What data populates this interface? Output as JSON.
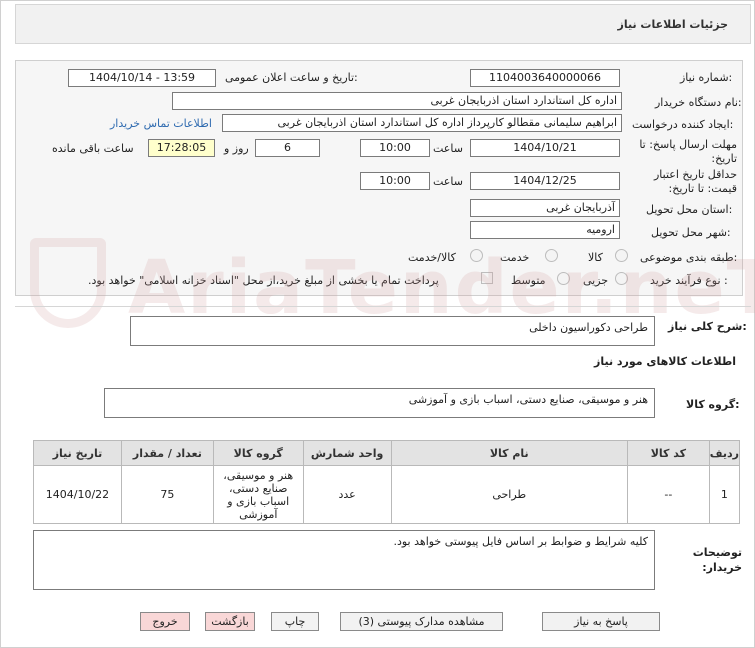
{
  "header": {
    "title": "جزئیات اطلاعات نیاز"
  },
  "labels": {
    "need_number": "شماره نیاز:",
    "announce_datetime": "تاریخ و ساعت اعلان عمومی:",
    "buyer_org": "نام دستگاه خریدار:",
    "requester": "ایجاد کننده درخواست:",
    "reply_deadline": "مهلت ارسال پاسخ: تا تاریخ:",
    "price_validity": "حداقل تاریخ اعتبار قیمت: تا تاریخ:",
    "delivery_province": "استان محل تحویل:",
    "delivery_city": "شهر محل تحویل:",
    "category": "طبقه بندی موضوعی:",
    "purchase_type": "نوع فرآیند خرید :",
    "time": "ساعت",
    "day_and": "روز و",
    "remaining": "ساعت باقی مانده"
  },
  "values": {
    "need_number": "1104003640000066",
    "announce_datetime": "1404/10/14 - 13:59",
    "buyer_org": "اداره کل استاندارد استان اذربایجان غربی",
    "requester": "ابراهیم سلیمانی مقطالو کارپرداز اداره کل استاندارد استان اذربایجان غربی",
    "contact_link": "اطلاعات تماس خریدار",
    "reply_date": "1404/10/21",
    "reply_time": "10:00",
    "reply_days": "6",
    "reply_remaining": "17:28:05",
    "validity_date": "1404/12/25",
    "validity_time": "10:00",
    "province": "آذربایجان غربی",
    "city": "ارومیه"
  },
  "category_options": [
    "کالا",
    "خدمت",
    "کالا/خدمت"
  ],
  "purchase_options": [
    "جزیی",
    "متوسط"
  ],
  "payment_note": "پرداخت تمام یا بخشی از مبلغ خرید،از محل \"اسناد خزانه اسلامی\" خواهد بود.",
  "description": {
    "label": "شرح کلی نیاز:",
    "value": "طراحی دکوراسیون داخلی"
  },
  "goods_section": {
    "title": "اطلاعات کالاهای مورد نیاز",
    "group_label": "گروه کالا:",
    "group_value": "هنر و موسیقی، صنایع دستی، اسباب بازی و آموزشی"
  },
  "table": {
    "headers": [
      "ردیف",
      "کد کالا",
      "نام کالا",
      "واحد شمارش",
      "گروه کالا",
      "تعداد / مقدار",
      "تاریخ نیاز"
    ],
    "rows": [
      [
        "1",
        "--",
        "طراحی",
        "عدد",
        "هنر و موسیقی، صنایع دستی، اسباب بازی و آموزشی",
        "75",
        "1404/10/22"
      ]
    ]
  },
  "buyer_notes": {
    "label": "توضیحات خریدار:",
    "value": "کلیه شرایط و ضوابط بر اساس فایل پیوستی خواهد بود."
  },
  "buttons": {
    "reply": "پاسخ به نیاز",
    "attachments": "مشاهده مدارک پیوستی (3)",
    "print": "چاپ",
    "back": "بازگشت",
    "exit": "خروج"
  },
  "watermark": "AriaTender.neT"
}
